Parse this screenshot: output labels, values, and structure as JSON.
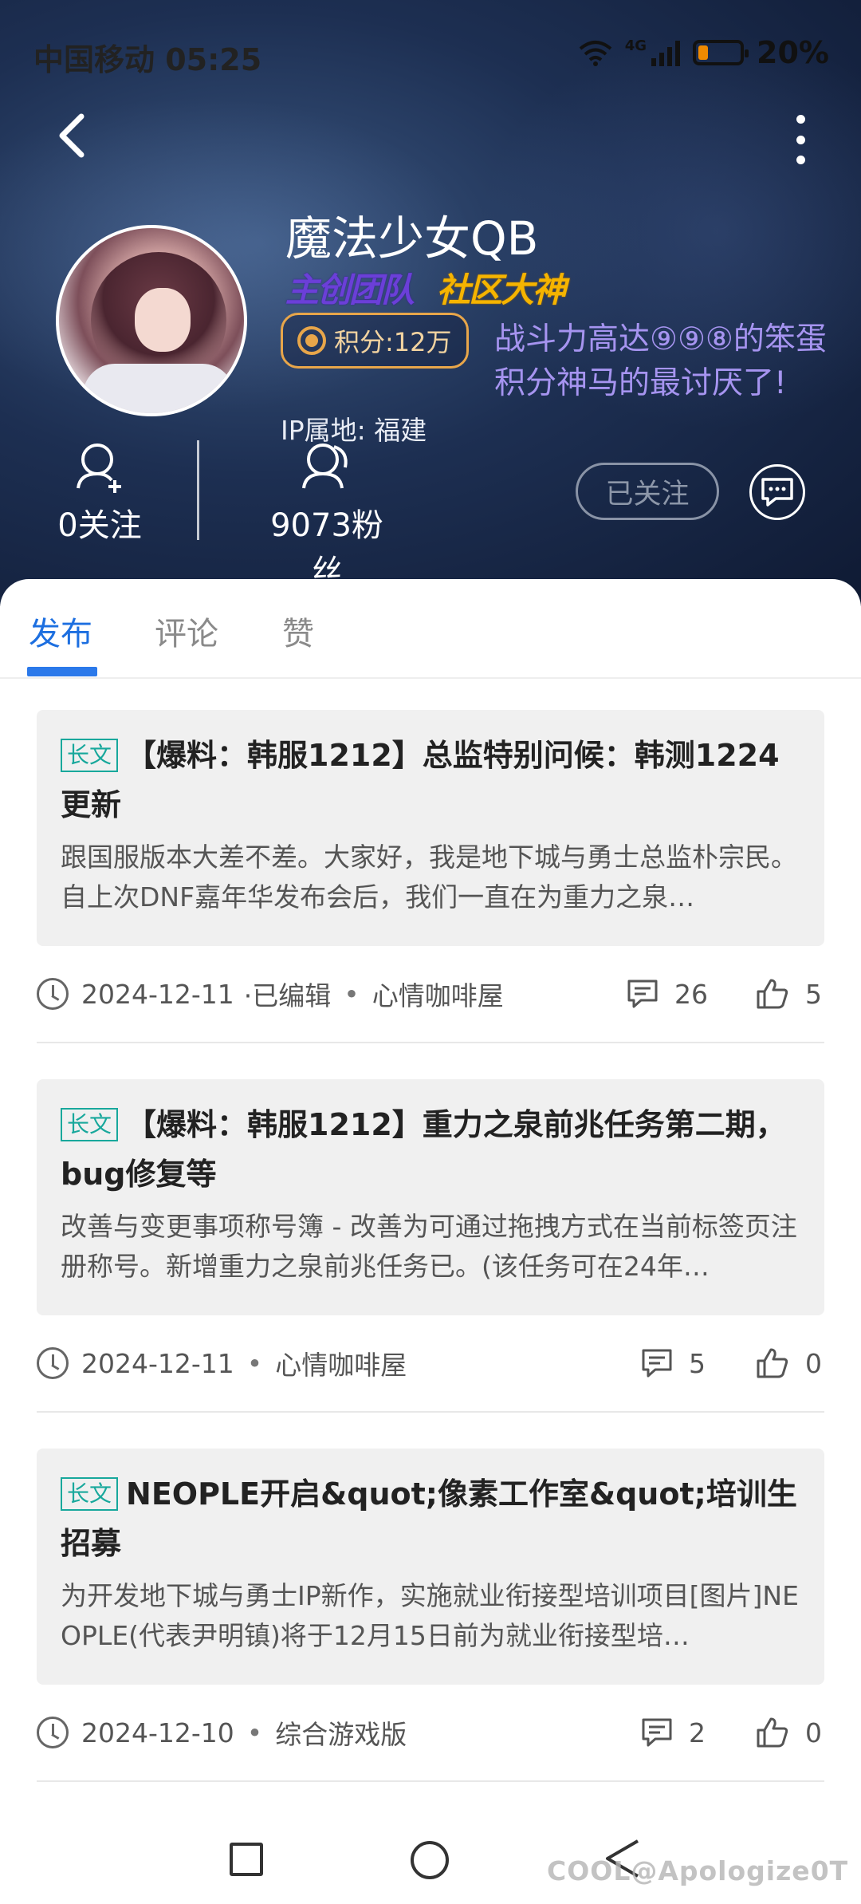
{
  "status_bar": {
    "carrier_time": "中国移动 05:25",
    "network": "4G",
    "battery": "20%",
    "battery_level": 0.2
  },
  "profile": {
    "username": "魔法少女QB",
    "badges": [
      "主创团队",
      "社区大神"
    ],
    "points": "积分:12万",
    "signature": "战斗力高达⑨⑨⑧的笨蛋\n积分神马的最讨厌了!",
    "ip_location": "IP属地: 福建",
    "following": "0关注",
    "fans": "9073粉丝",
    "follow_button": "已关注"
  },
  "tabs": [
    {
      "label": "发布",
      "active": true
    },
    {
      "label": "评论",
      "active": false
    },
    {
      "label": "赞",
      "active": false
    }
  ],
  "posts": [
    {
      "tag": "长文",
      "title": "【爆料：韩服1212】总监特别问候：韩测1224更新",
      "summary": " 跟国服版本大差不差。大家好，我是地下城与勇士总监朴宗民。自上次DNF嘉年华发布会后，我们一直在为重力之泉…",
      "date": "2024-12-11",
      "edited": "·已编辑",
      "board": "心情咖啡屋",
      "comments": "26",
      "likes": "5"
    },
    {
      "tag": "长文",
      "title": "【爆料：韩服1212】重力之泉前兆任务第二期，bug修复等",
      "summary": "改善与变更事项称号簿 - 改善为可通过拖拽方式在当前标签页注册称号。新增重力之泉前兆任务已。(该任务可在24年…",
      "date": "2024-12-11",
      "edited": "",
      "board": "心情咖啡屋",
      "comments": "5",
      "likes": "0"
    },
    {
      "tag": "长文",
      "title": "NEOPLE开启&quot;像素工作室&quot;培训生招募",
      "summary": "为开发地下城与勇士IP新作，实施就业衔接型培训项目[图片]NEOPLE(代表尹明镇)将于12月15日前为就业衔接型培…",
      "date": "2024-12-10",
      "edited": "",
      "board": "综合游戏版",
      "comments": "2",
      "likes": "0"
    }
  ],
  "meta_separator": "•",
  "watermark": "COOL@Apologize0T",
  "colors": {
    "accent": "#2b79ea",
    "tag": "#18a89c",
    "badge_team": "#6b3fd8",
    "badge_god": "#f5b400",
    "points_border": "#e8a64a",
    "signature": "#a694f0"
  },
  "icons": [
    "back-icon",
    "more-icon",
    "wifi-icon",
    "signal-icon",
    "battery-icon",
    "medal-icon",
    "follow-user-icon",
    "fans-icon",
    "chat-icon",
    "clock-icon",
    "comment-icon",
    "like-icon"
  ]
}
